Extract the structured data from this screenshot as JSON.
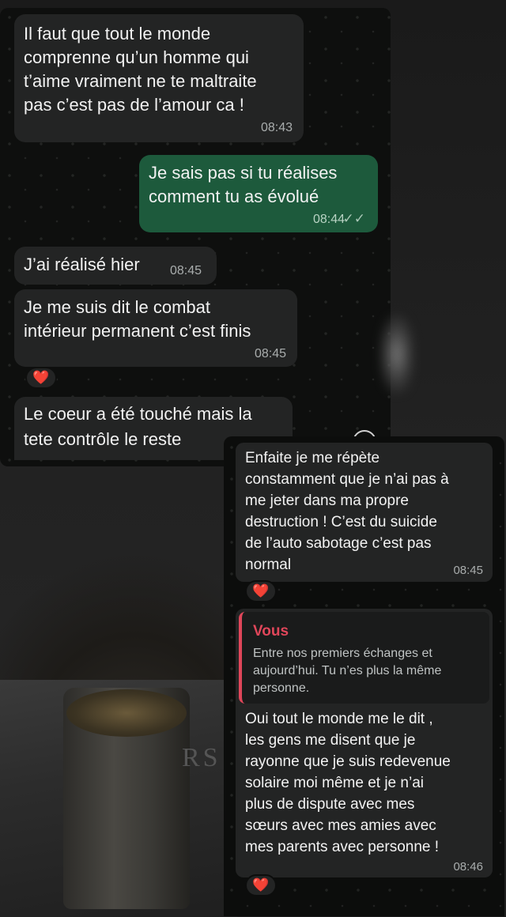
{
  "conversation_top": {
    "messages": [
      {
        "direction": "incoming",
        "text": "Il faut que tout le monde\ncomprenne qu’un homme qui\nt’aime vraiment ne te maltraite\npas c’est pas de l’amour ca !",
        "time": "08:43"
      },
      {
        "direction": "outgoing",
        "text": "Je sais pas si tu réalises\ncomment tu as évolué",
        "time": "08:44",
        "status": "read"
      },
      {
        "direction": "incoming",
        "text": "J’ai réalisé hier",
        "time": "08:45"
      },
      {
        "direction": "incoming",
        "text": "Je me suis dit le combat\nintérieur permanent c’est finis",
        "time": "08:45",
        "reaction": "❤️"
      },
      {
        "direction": "incoming",
        "text": "Le coeur a été touché mais la\ntete contrôle le reste"
      }
    ]
  },
  "conversation_bottom": {
    "messages": [
      {
        "direction": "incoming",
        "text": "Enfaite je me répète\nconstamment que je n’ai pas à\nme jeter dans ma propre\ndestruction ! C’est du suicide\nde l’auto sabotage c’est pas\nnormal",
        "time": "08:45",
        "reaction": "❤️"
      },
      {
        "direction": "incoming",
        "quote": {
          "author": "Vous",
          "text": "Entre nos premiers échanges et\naujourd’hui. Tu n’es plus la même\npersonne."
        },
        "text": "Oui tout le monde me le dit ,\nles gens me disent que je\nrayonne que je suis redevenue\nsolaire moi même et je n’ai\nplus de dispute avec mes\nsœurs avec mes amies avec\nmes parents avec personne !",
        "time": "08:46",
        "reaction": "❤️"
      }
    ]
  },
  "background": {
    "book_text": "RS I"
  },
  "colors": {
    "incoming_bubble": "#232424",
    "outgoing_bubble": "#1d5a3c",
    "quote_accent": "#e0465a",
    "reaction": "#e8112d"
  },
  "icons": {
    "read_ticks": "✓✓",
    "scroll_down": "chevron-down-icon"
  }
}
